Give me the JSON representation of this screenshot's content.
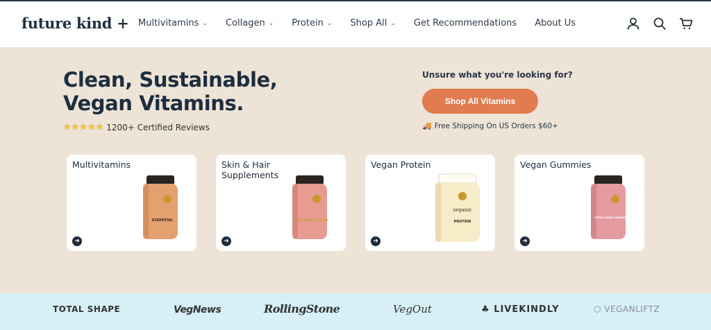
{
  "header": {
    "logo": "future kind",
    "logo_plus": "+",
    "nav": [
      {
        "label": "Multivitamins",
        "has_dropdown": true
      },
      {
        "label": "Collagen",
        "has_dropdown": true
      },
      {
        "label": "Protein",
        "has_dropdown": true
      },
      {
        "label": "Shop All",
        "has_dropdown": true
      },
      {
        "label": "Get Recommendations",
        "has_dropdown": false
      },
      {
        "label": "About Us",
        "has_dropdown": false
      }
    ],
    "icons": [
      "account-icon",
      "search-icon",
      "cart-icon"
    ]
  },
  "hero": {
    "title_line1": "Clean, Sustainable,",
    "title_line2": "Vegan Vitamins.",
    "stars": "★★★★★",
    "reviews": "1200+ Certified Reviews",
    "unsure": "Unsure what you're looking for?",
    "cta": "Shop All Vitamins",
    "shipping": "Free Shipping On US Orders $60+"
  },
  "categories": [
    {
      "label": "Multivitamins",
      "bottle_label": "ESSENTIAL",
      "bottle_color": "#e3a16f"
    },
    {
      "label": "Skin & Hair Supplements",
      "bottle_label": "COLLAGEN BOOSTER",
      "bottle_color": "#e79b91"
    },
    {
      "label": "Vegan Protein",
      "bottle_label": "PROTEIN",
      "bottle_color": "#f6ecc8"
    },
    {
      "label": "Vegan Gummies",
      "bottle_label": "APPLE CIDER VINEGAR",
      "bottle_color": "#e59aa0"
    }
  ],
  "press": [
    "TOTAL SHAPE",
    "VegNews",
    "RollingStone",
    "VegOut",
    "LIVEKINDLY",
    "VEGANLIFTZ"
  ],
  "colors": {
    "hero_bg": "#ede3d7",
    "cta": "#e07c50",
    "navy": "#1d2e3e",
    "press_bg": "#d7eff7"
  }
}
